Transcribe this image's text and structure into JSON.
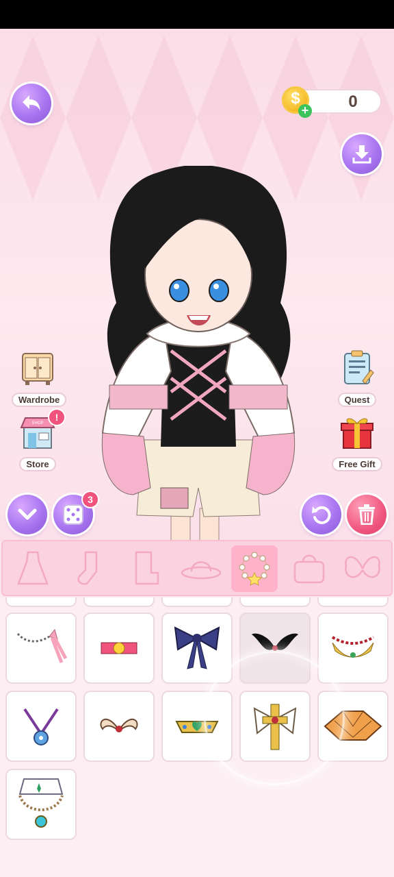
{
  "coins": {
    "value": "0"
  },
  "side_menu": {
    "wardrobe": "Wardrobe",
    "store": "Store",
    "store_sign": "SHOP",
    "store_alert": "!",
    "quest": "Quest",
    "free_gift": "Free Gift"
  },
  "dice_badge": "3",
  "categories": [
    {
      "icon": "dress-icon"
    },
    {
      "icon": "socks-icon"
    },
    {
      "icon": "boots-icon"
    },
    {
      "icon": "hat-icon"
    },
    {
      "icon": "necklace-icon",
      "active": true
    },
    {
      "icon": "bag-icon"
    },
    {
      "icon": "wings-icon"
    }
  ],
  "items": [
    "pink-bow-chain-necklace",
    "red-gem-choker",
    "navy-bow-collar",
    "black-feather-collar",
    "red-bead-gold-necklace",
    "blue-flower-pendant",
    "horn-ornament",
    "green-heart-tiara",
    "white-bow-cross-brooch",
    "orange-ornate-collar",
    "lace-collar-pearl-necklace"
  ],
  "colors": {
    "accent_purple": "#a875f0",
    "accent_red": "#f0577e",
    "tab_bg": "#fbd2e0"
  }
}
